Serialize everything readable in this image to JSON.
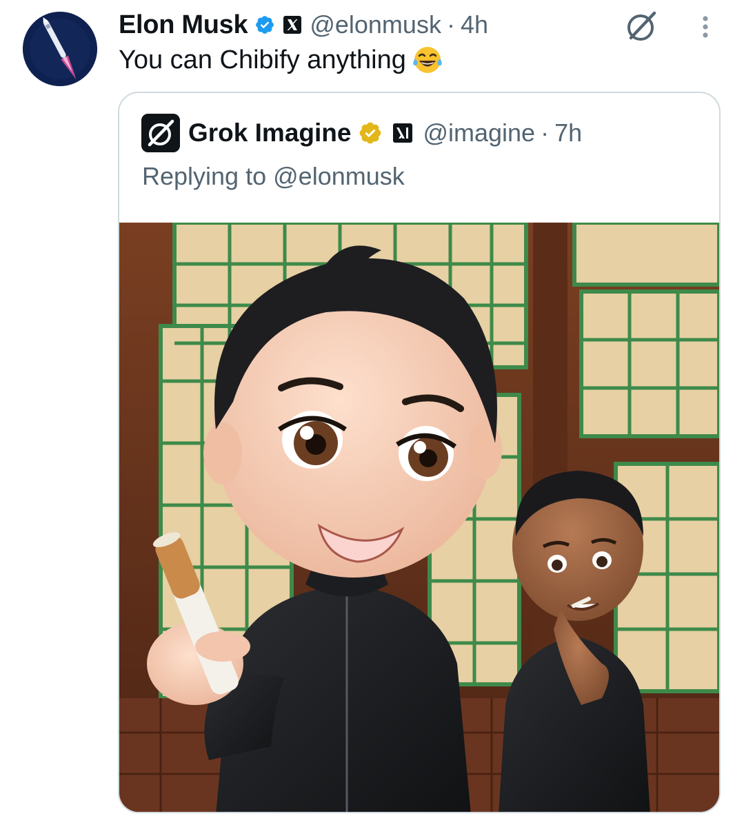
{
  "post": {
    "author": {
      "name": "Elon Musk",
      "handle": "@elonmusk",
      "verified_badge_icon": "blue-verified-badge-icon",
      "affiliate_icon": "x-logo-icon"
    },
    "separator": "·",
    "time": "4h",
    "text": "You can Chibify anything",
    "emoji": "😂",
    "actions": {
      "grok_icon": "grok-icon",
      "more_icon": "more-vertical-icon"
    }
  },
  "quote": {
    "author": {
      "name": "Grok Imagine",
      "handle": "@imagine",
      "verified_badge_icon": "gold-verified-badge-icon",
      "affiliate_icon": "xai-logo-icon"
    },
    "separator": "·",
    "time": "7h",
    "reply_prefix": "Replying to",
    "reply_to": "@elonmusk"
  },
  "colors": {
    "text_primary": "#0f1419",
    "text_secondary": "#536471",
    "verified_blue": "#1d9bf0",
    "verified_gold": "#e2b719",
    "border": "#cfd9de"
  }
}
